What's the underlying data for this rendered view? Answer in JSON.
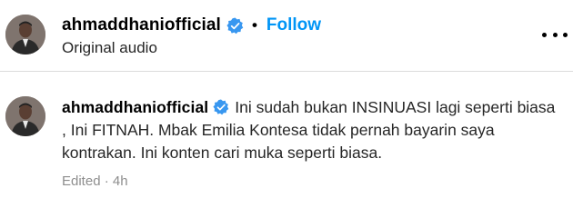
{
  "post": {
    "username": "ahmaddhaniofficial",
    "follow_label": "Follow",
    "separator": "•",
    "audio_label": "Original audio",
    "more_icon": "more-options-icon"
  },
  "comment": {
    "username": "ahmaddhaniofficial",
    "text": "Ini sudah bukan INSINUASI lagi seperti biasa , Ini FITNAH. Mbak Emilia Kontesa tidak pernah bayarin saya kontrakan. Ini konten cari muka seperti biasa.",
    "edited_label": "Edited",
    "meta_separator": "·",
    "time": "4h"
  },
  "colors": {
    "follow": "#0095f6",
    "verified": "#3897f0",
    "muted": "#8e8e8e"
  }
}
